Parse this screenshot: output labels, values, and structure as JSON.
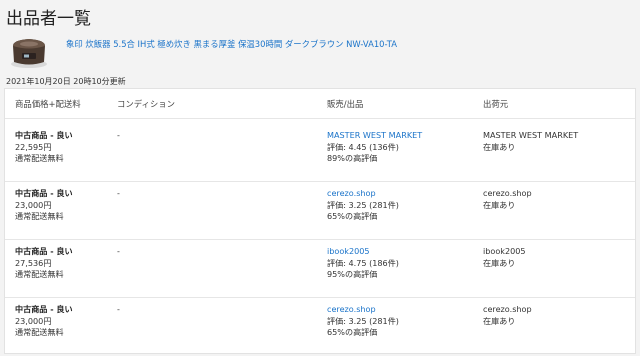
{
  "page": {
    "title": "出品者一覧",
    "updated": "2021年10月20日 20時10分更新"
  },
  "product": {
    "title": "象印 炊飯器 5.5合 IH式 極め炊き 黒まる厚釜 保温30時間 ダークブラウン NW-VA10-TA",
    "thumb_icon": "rice-cooker-image"
  },
  "table": {
    "headers": [
      "商品価格+配送料",
      "コンディション",
      "販売/出品",
      "出荷元"
    ],
    "rows": [
      {
        "condition_label": "中古商品 - 良い",
        "price": "22,595円",
        "shipping": "通常配送無料",
        "condition_note": "-",
        "seller": "MASTER WEST MARKET",
        "rating": "評価: 4.45 (136件)",
        "positive": "89%の高評価",
        "ship_from": "MASTER WEST MARKET",
        "stock": "在庫あり"
      },
      {
        "condition_label": "中古商品 - 良い",
        "price": "23,000円",
        "shipping": "通常配送無料",
        "condition_note": "-",
        "seller": "cerezo.shop",
        "rating": "評価: 3.25 (281件)",
        "positive": "65%の高評価",
        "ship_from": "cerezo.shop",
        "stock": "在庫あり"
      },
      {
        "condition_label": "中古商品 - 良い",
        "price": "27,536円",
        "shipping": "通常配送無料",
        "condition_note": "-",
        "seller": "ibook2005",
        "rating": "評価: 4.75 (186件)",
        "positive": "95%の高評価",
        "ship_from": "ibook2005",
        "stock": "在庫あり"
      },
      {
        "condition_label": "中古商品 - 良い",
        "price": "23,000円",
        "shipping": "通常配送無料",
        "condition_note": "-",
        "seller": "cerezo.shop",
        "rating": "評価: 3.25 (281件)",
        "positive": "65%の高評価",
        "ship_from": "cerezo.shop",
        "stock": "在庫あり"
      }
    ]
  },
  "colors": {
    "link": "#1a73c9",
    "background": "#f3f3f3",
    "panel": "#ffffff"
  }
}
